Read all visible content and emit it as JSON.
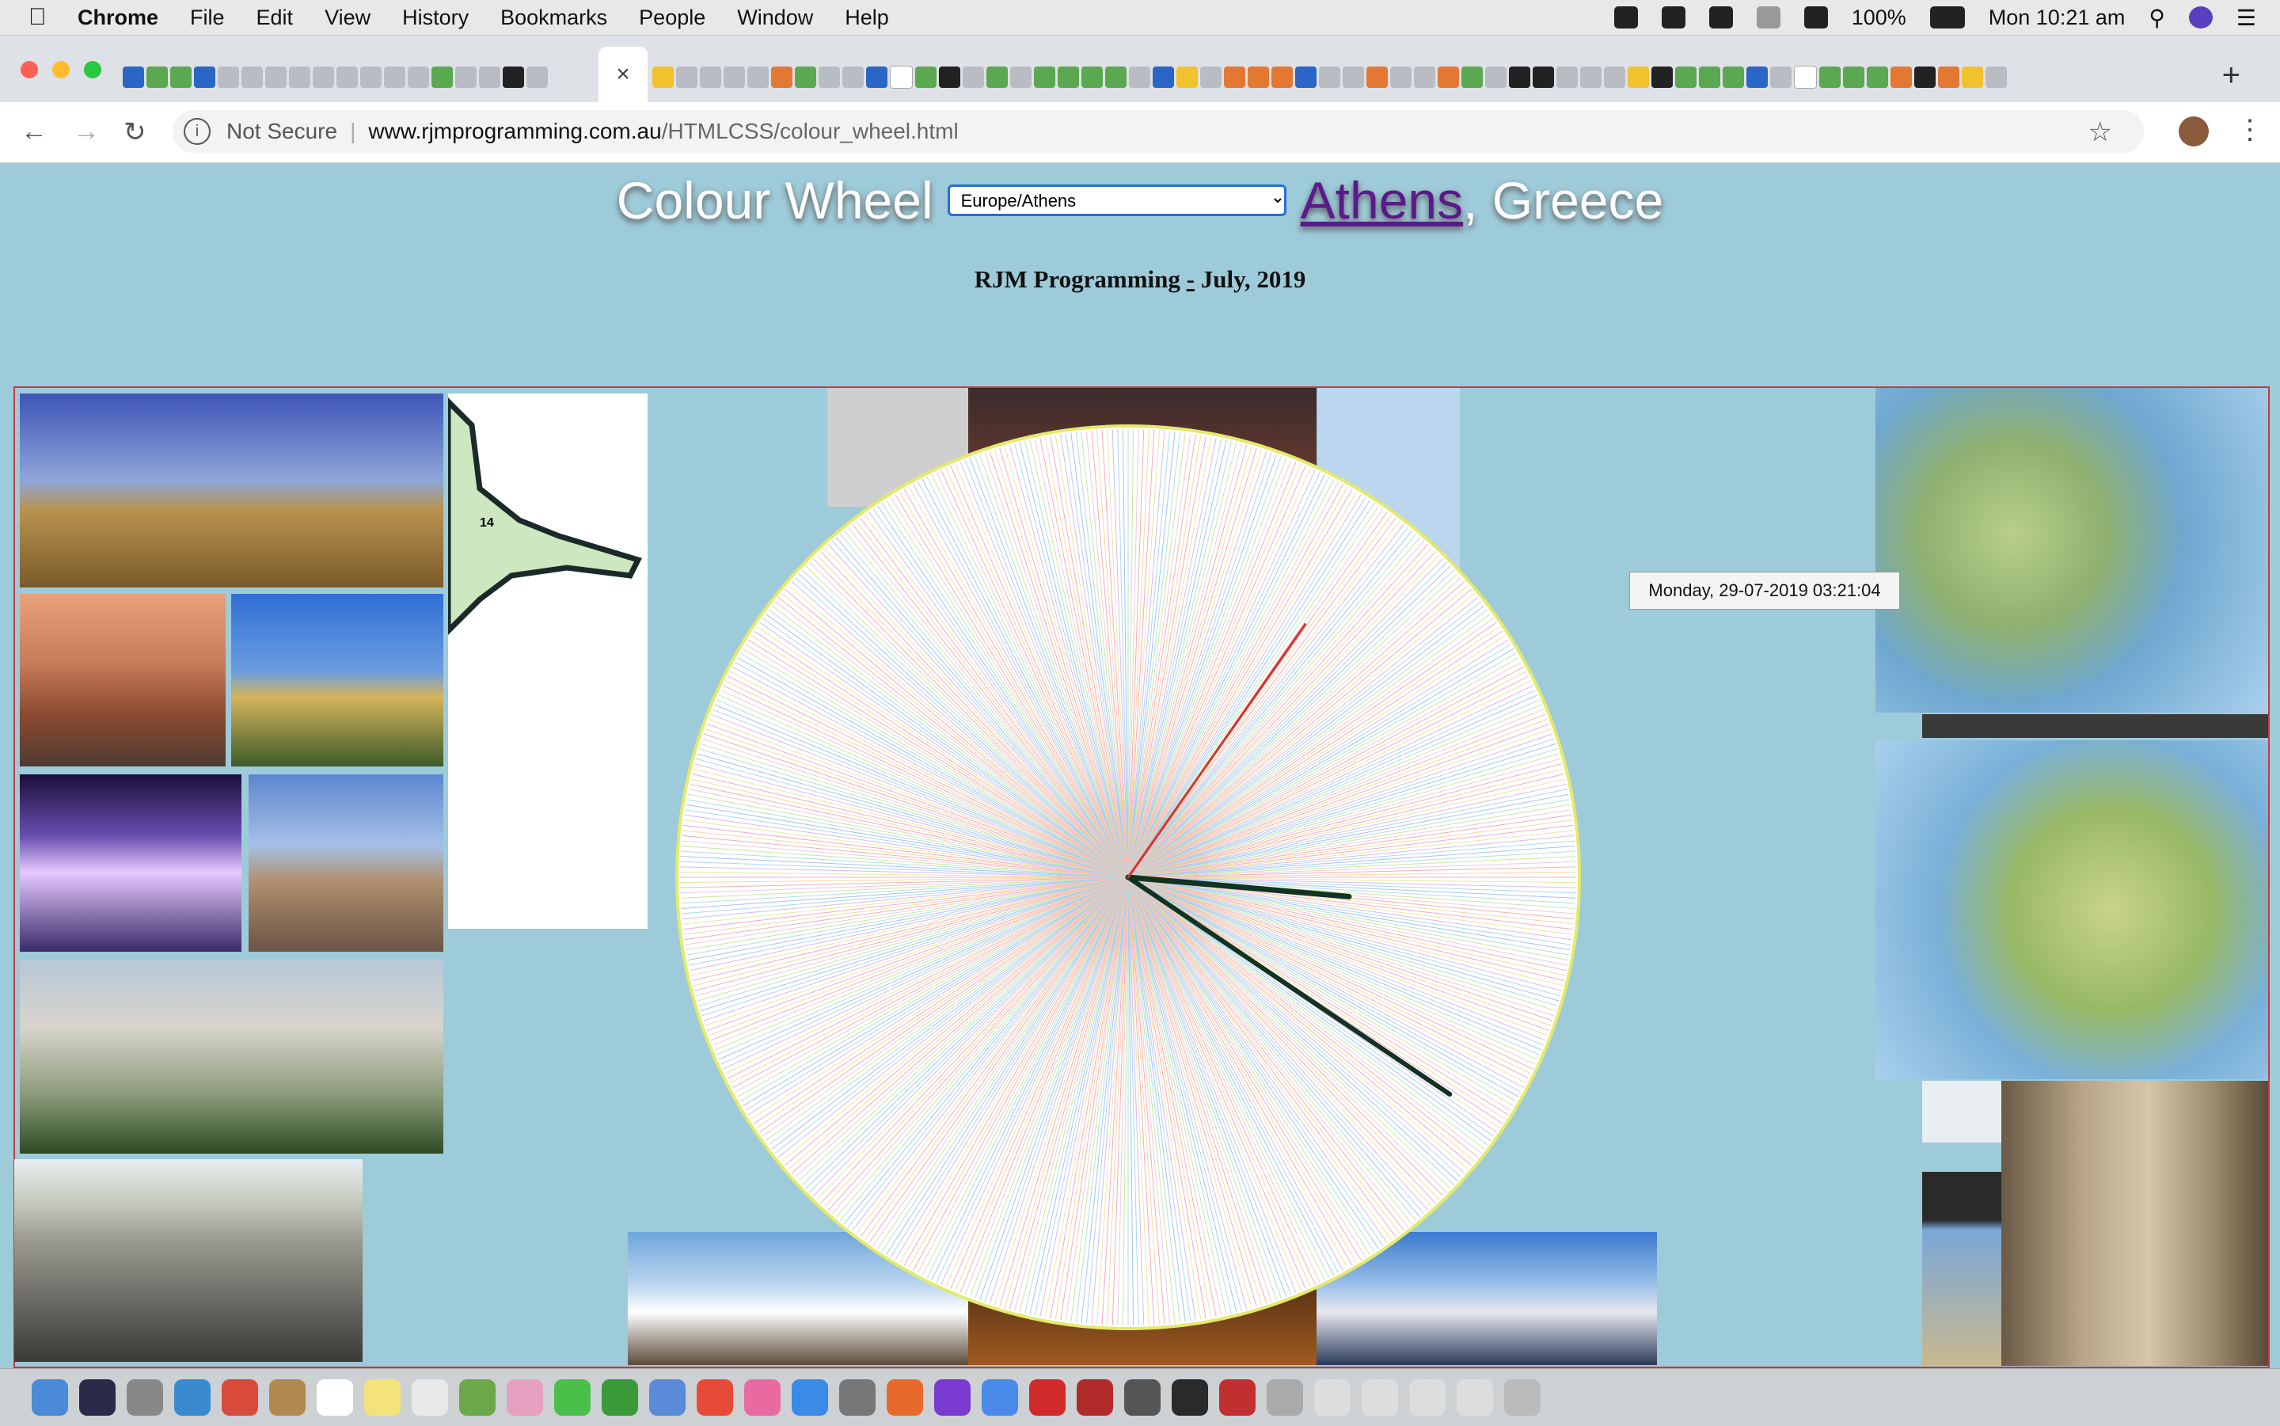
{
  "menubar": {
    "app": "Chrome",
    "items": [
      "File",
      "Edit",
      "View",
      "History",
      "Bookmarks",
      "People",
      "Window",
      "Help"
    ],
    "battery": "100%",
    "clock": "Mon 10:21 am"
  },
  "browser": {
    "tab_close": "×",
    "new_tab": "+",
    "security_label": "Not Secure",
    "url_host": "www.rjmprogramming.com.au",
    "url_path": "/HTMLCSS/colour_wheel.html"
  },
  "page": {
    "title": "Colour Wheel",
    "timezone_selected": "Europe/Athens",
    "city": "Athens",
    "country_suffix": ", Greece",
    "subtitle_author": "RJM Programming",
    "subtitle_dash": "-",
    "subtitle_date": "July, 2019",
    "clock_tooltip": "Monday, 29-07-2019 03:21:04",
    "map_region_number": "14"
  },
  "clock": {
    "hour_hand_angle_deg": 95,
    "minute_hand_angle_deg": 124,
    "second_hand_angle_deg": 35
  },
  "colors": {
    "page_bg": "#9ecbd9",
    "frame_border": "#c8383c",
    "select_border": "#2d6bd6",
    "link_visited": "#5a1a8a",
    "second_hand": "#d9302e",
    "hour_minute_hands": "#123322"
  }
}
